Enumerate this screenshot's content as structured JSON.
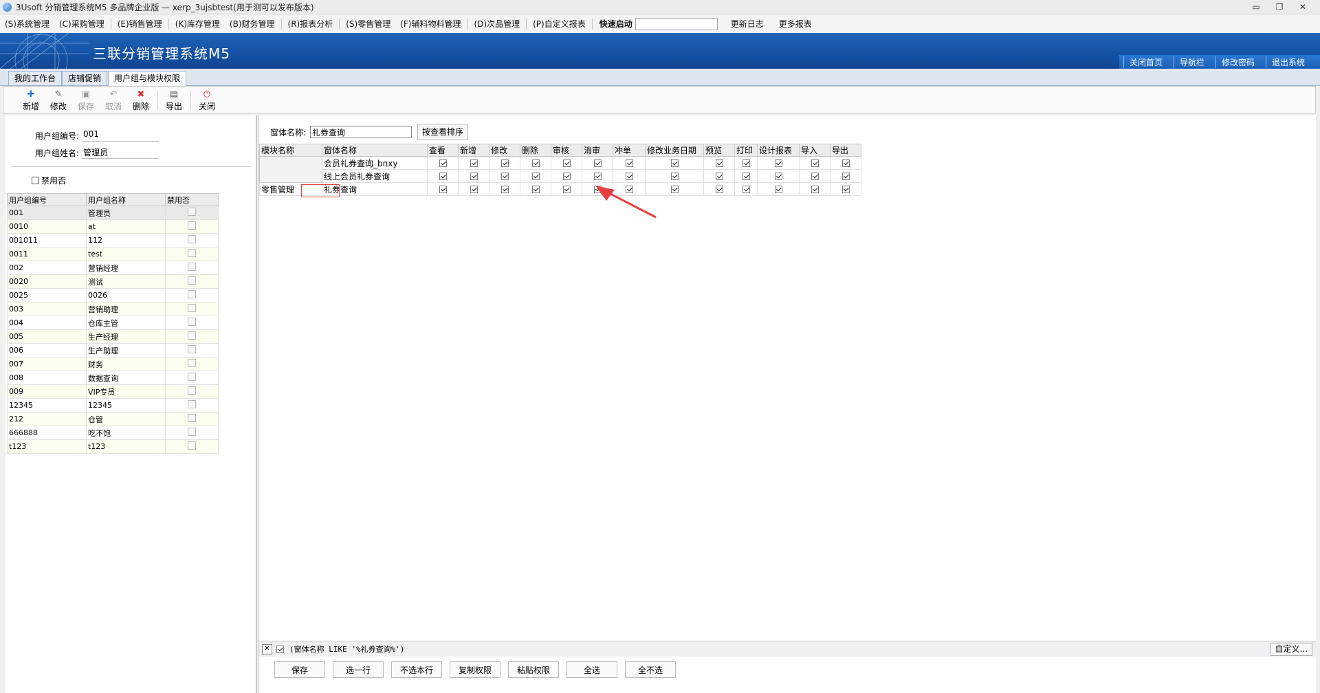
{
  "window": {
    "title": "3Usoft 分销管理系统M5 多品牌企业版 — xerp_3ujsbtest(用于测可以发布版本)"
  },
  "menu": {
    "items": [
      "(S)系统管理",
      "(C)采购管理",
      "(E)销售管理",
      "(K)库存管理",
      "(B)财务管理",
      "(R)报表分析",
      "(S)零售管理",
      "(F)辅料物料管理",
      "(D)次品管理",
      "(P)自定义报表"
    ],
    "quick_label": "快速启动",
    "update_log": "更新日志",
    "more_reports": "更多报表"
  },
  "banner": {
    "title": "三联分销管理系统M5",
    "links": [
      "关闭首页",
      "导航栏",
      "修改密码",
      "退出系统"
    ]
  },
  "tabs": [
    "我的工作台",
    "店铺促销",
    "用户组与模块权限"
  ],
  "toolbar": {
    "new": "新增",
    "edit": "修改",
    "save": "保存",
    "cancel": "取消",
    "delete": "删除",
    "export": "导出",
    "close": "关闭"
  },
  "form": {
    "group_no_label": "用户组编号:",
    "group_no": "001",
    "group_name_label": "用户组姓名:",
    "group_name": "管理员",
    "disabled_label": "禁用否"
  },
  "groups": {
    "headers": [
      "用户组编号",
      "用户组名称",
      "禁用否"
    ],
    "rows": [
      [
        "001",
        "管理员"
      ],
      [
        "0010",
        "at"
      ],
      [
        "001011",
        "112"
      ],
      [
        "0011",
        "test"
      ],
      [
        "002",
        "营销经理"
      ],
      [
        "0020",
        "测试"
      ],
      [
        "0025",
        "0026"
      ],
      [
        "003",
        "营销助理"
      ],
      [
        "004",
        "仓库主管"
      ],
      [
        "005",
        "生产经理"
      ],
      [
        "006",
        "生产助理"
      ],
      [
        "007",
        "财务"
      ],
      [
        "008",
        "数据查询"
      ],
      [
        "009",
        "VIP专员"
      ],
      [
        "12345",
        "12345"
      ],
      [
        "212",
        "仓管"
      ],
      [
        "666888",
        "吃不饱"
      ],
      [
        "t123",
        "t123"
      ]
    ]
  },
  "permissions": {
    "filter_label": "窗体名称:",
    "filter_value": "礼券查询",
    "sort_button": "按查看排序",
    "headers": [
      "模块名称",
      "窗体名称",
      "查看",
      "新增",
      "修改",
      "删除",
      "审核",
      "消审",
      "冲单",
      "修改业务日期",
      "预览",
      "打印",
      "设计报表",
      "导入",
      "导出"
    ],
    "rows": [
      {
        "module": "",
        "form": "会员礼券查询_bnxy"
      },
      {
        "module": "",
        "form": "线上会员礼券查询"
      },
      {
        "module": "零售管理",
        "form": "礼券查询"
      }
    ],
    "filter_expression": "(窗体名称 LIKE '%礼券查询%')",
    "custom_button": "自定义..."
  },
  "actions": [
    "保存",
    "选一行",
    "不选本行",
    "复制权限",
    "粘贴权限",
    "全选",
    "全不选"
  ]
}
